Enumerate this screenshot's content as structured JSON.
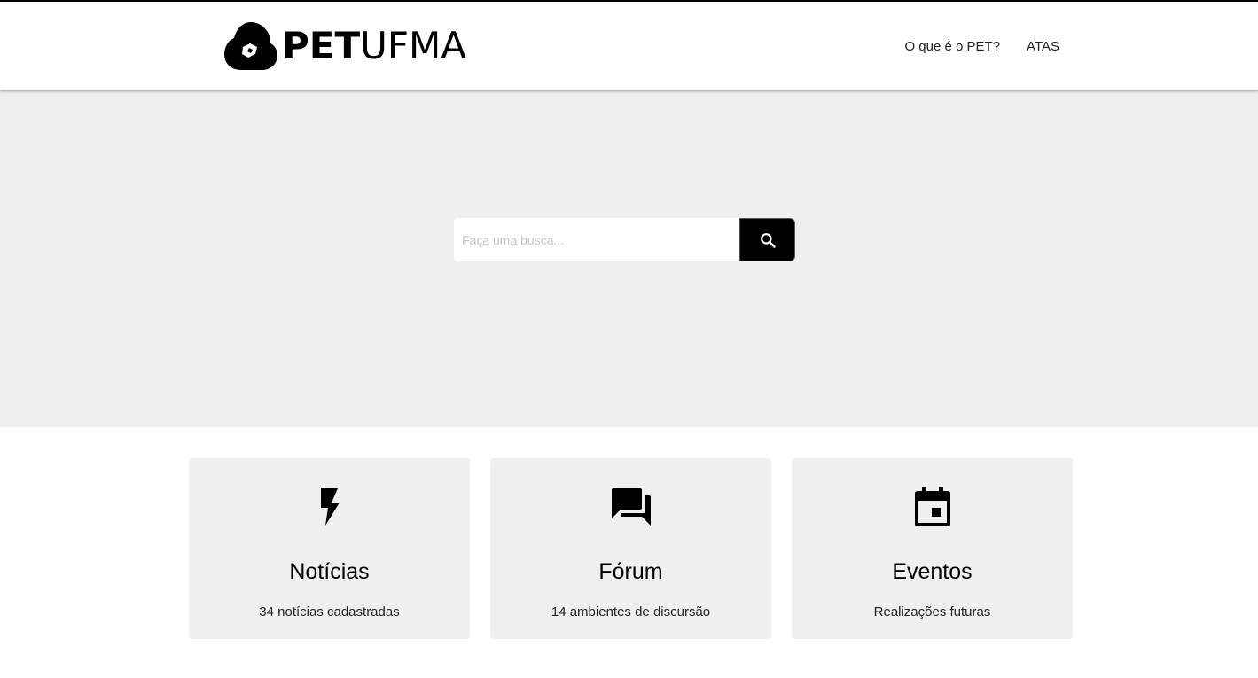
{
  "header": {
    "logo": {
      "bold": "PET",
      "regular": "UFMA"
    },
    "nav": [
      {
        "label": "O que é o PET?"
      },
      {
        "label": "ATAS"
      }
    ]
  },
  "hero": {
    "search": {
      "placeholder": "Faça uma busca...",
      "button_icon": "search-icon"
    }
  },
  "cards": [
    {
      "icon": "lightning-bolt-icon",
      "title": "Notícias",
      "subtitle": "34 notícias cadastradas"
    },
    {
      "icon": "forum-icon",
      "title": "Fórum",
      "subtitle": "14 ambientes de discursão"
    },
    {
      "icon": "calendar-icon",
      "title": "Eventos",
      "subtitle": "Realizações futuras"
    }
  ],
  "colors": {
    "hero_bg": "#efefef",
    "card_bg": "#efefef",
    "button_bg": "#000000"
  }
}
